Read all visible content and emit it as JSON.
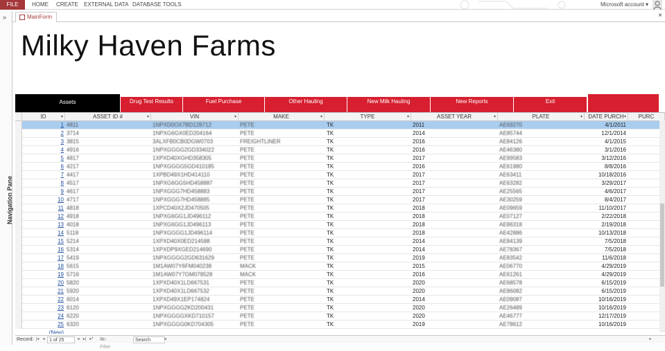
{
  "ribbon": {
    "file": "FILE",
    "tabs": [
      "HOME",
      "CREATE",
      "EXTERNAL DATA",
      "DATABASE TOOLS"
    ],
    "account": "Microsoft account"
  },
  "navpane": {
    "label": "Navigation Pane",
    "chevron": "»"
  },
  "doc": {
    "tab_label": "MainForm",
    "close": "×"
  },
  "form": {
    "title": "Milky Haven Farms",
    "nav_buttons": [
      "Assets",
      "Drug Test Results",
      "Fuel Purchase",
      "Other Hauling",
      "New Milk Hauling",
      "New Reports",
      "Exit",
      ""
    ]
  },
  "grid": {
    "columns": [
      "ID",
      "ASSET ID #",
      "VIN",
      "MAKE",
      "TYPE",
      "ASSET YEAR",
      "PLATE",
      "DATE PURCH",
      "PURC"
    ],
    "rows": [
      {
        "id": "1",
        "asset": "4811",
        "vin": "1NPXD0OX7BD128712",
        "make": "PETE",
        "type": "TK",
        "year": "2011",
        "plate": "AE69270",
        "date": "4/1/2011"
      },
      {
        "id": "2",
        "asset": "3714",
        "vin": "1NPXG6GX0ED204164",
        "make": "PETE",
        "type": "TK",
        "year": "2014",
        "plate": "AE85744",
        "date": "12/1/2014"
      },
      {
        "id": "3",
        "asset": "3815",
        "vin": "3ALXFB0CB0DGW0703",
        "make": "FREIGHTLINER",
        "type": "TK",
        "year": "2016",
        "plate": "AE84126",
        "date": "4/1/2015"
      },
      {
        "id": "4",
        "asset": "4916",
        "vin": "1NPXGGGG2GD334022",
        "make": "PETE",
        "type": "TK",
        "year": "2016",
        "plate": "AE46380",
        "date": "3/1/2016"
      },
      {
        "id": "5",
        "asset": "4817",
        "vin": "1XPXD40XGHD358305",
        "make": "PETE",
        "type": "TK",
        "year": "2017",
        "plate": "AE99583",
        "date": "3/12/2016"
      },
      {
        "id": "6",
        "asset": "4217",
        "vin": "1NPXGGGG5GD410185",
        "make": "PETE",
        "type": "TK",
        "year": "2016",
        "plate": "AE61980",
        "date": "8/8/2016"
      },
      {
        "id": "7",
        "asset": "4417",
        "vin": "1XPBD49X1HD414110",
        "make": "PETE",
        "type": "TK",
        "year": "2017",
        "plate": "AE63411",
        "date": "10/18/2016"
      },
      {
        "id": "8",
        "asset": "4517",
        "vin": "1NPXG6GG5HD458887",
        "make": "PETE",
        "type": "TK",
        "year": "2017",
        "plate": "AE63282",
        "date": "3/29/2017"
      },
      {
        "id": "9",
        "asset": "4617",
        "vin": "1NPXGGG7HD458883",
        "make": "PETE",
        "type": "TK",
        "year": "2017",
        "plate": "AE25565",
        "date": "4/6/2017"
      },
      {
        "id": "10",
        "asset": "4717",
        "vin": "1NPXGGG7HD458885",
        "make": "PETE",
        "type": "TK",
        "year": "2017",
        "plate": "AE30259",
        "date": "8/4/2017"
      },
      {
        "id": "11",
        "asset": "4818",
        "vin": "1XPCD40X2JD470505",
        "make": "PETE",
        "type": "TK",
        "year": "2018",
        "plate": "AE09659",
        "date": "11/10/2017"
      },
      {
        "id": "12",
        "asset": "4918",
        "vin": "1NPXG6GG1JD496112",
        "make": "PETE",
        "type": "TK",
        "year": "2018",
        "plate": "AE07127",
        "date": "2/22/2018"
      },
      {
        "id": "13",
        "asset": "4018",
        "vin": "1NPXG6GG1JD496113",
        "make": "PETE",
        "type": "TK",
        "year": "2018",
        "plate": "AE86318",
        "date": "2/19/2018"
      },
      {
        "id": "14",
        "asset": "5118",
        "vin": "1NPXGGGG1JD496114",
        "make": "PETE",
        "type": "TK",
        "year": "2018",
        "plate": "AE42886",
        "date": "10/13/2018"
      },
      {
        "id": "15",
        "asset": "5214",
        "vin": "1XPXD40X0ED214588",
        "make": "PETE",
        "type": "TK",
        "year": "2014",
        "plate": "AE84139",
        "date": "7/5/2018"
      },
      {
        "id": "16",
        "asset": "5314",
        "vin": "1XPXDP9XGED214690",
        "make": "PETE",
        "type": "TK",
        "year": "2014",
        "plate": "AE78367",
        "date": "7/5/2018"
      },
      {
        "id": "17",
        "asset": "5419",
        "vin": "1NPXGGGG2GD631629",
        "make": "PETE",
        "type": "TK",
        "year": "2019",
        "plate": "AE83542",
        "date": "11/6/2018"
      },
      {
        "id": "18",
        "asset": "5615",
        "vin": "1M1AW07Y6FM040238",
        "make": "MACK",
        "type": "TK",
        "year": "2015",
        "plate": "AE06770",
        "date": "4/29/2019"
      },
      {
        "id": "19",
        "asset": "5716",
        "vin": "1M1AW07Y7GM078528",
        "make": "MACK",
        "type": "TK",
        "year": "2016",
        "plate": "AE61261",
        "date": "4/29/2019"
      },
      {
        "id": "20",
        "asset": "5820",
        "vin": "1XPXD40X1LD667531",
        "make": "PETE",
        "type": "TK",
        "year": "2020",
        "plate": "AE68578",
        "date": "6/15/2019"
      },
      {
        "id": "21",
        "asset": "5920",
        "vin": "1XPXD40X1LD667532",
        "make": "PETE",
        "type": "TK",
        "year": "2020",
        "plate": "AE86082",
        "date": "6/15/2019"
      },
      {
        "id": "22",
        "asset": "6014",
        "vin": "1XPXD49X1EP174824",
        "make": "PETE",
        "type": "TK",
        "year": "2014",
        "plate": "AE09087",
        "date": "10/16/2019"
      },
      {
        "id": "23",
        "asset": "6120",
        "vin": "1NPXGGGG2KD200431",
        "make": "PETE",
        "type": "TK",
        "year": "2020",
        "plate": "AE26489",
        "date": "10/16/2019"
      },
      {
        "id": "24",
        "asset": "6220",
        "vin": "1NPXGGGGXKD710157",
        "make": "PETE",
        "type": "TK",
        "year": "2020",
        "plate": "AE46777",
        "date": "12/17/2019"
      },
      {
        "id": "25",
        "asset": "6320",
        "vin": "1NPXGGGG0KD704305",
        "make": "PETE",
        "type": "TK",
        "year": "2019",
        "plate": "AE78612",
        "date": "10/16/2019"
      }
    ],
    "new_row_label": "(New)"
  },
  "status": {
    "record_label": "Record:",
    "record_value": "1 of 25",
    "filter": "No Filter",
    "search": "Search"
  },
  "colors": {
    "accent": "#d71f2f",
    "file_tab": "#a4373a",
    "selected_row": "#a9cdef"
  }
}
